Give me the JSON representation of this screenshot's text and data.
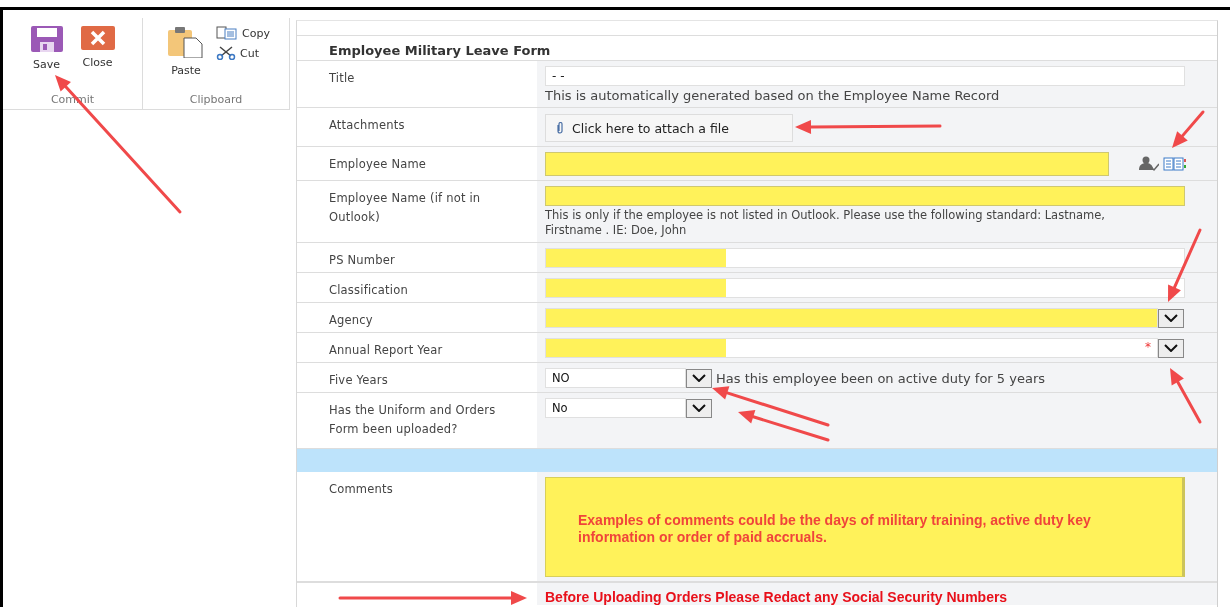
{
  "ribbon": {
    "groups": [
      {
        "label": "Commit",
        "buttons": [
          {
            "label": "Save"
          },
          {
            "label": "Close"
          }
        ]
      },
      {
        "label": "Clipboard",
        "buttons": [
          {
            "label": "Paste"
          },
          {
            "label": "Copy"
          },
          {
            "label": "Cut"
          }
        ]
      }
    ]
  },
  "form": {
    "title": "Employee Military Leave Form",
    "sections": [
      {
        "rows": [
          {
            "kind": "text",
            "label": "Title",
            "value": "- -",
            "highlighted": false,
            "hint": "This is automatically generated based on the Employee Name Record"
          },
          {
            "kind": "attach",
            "label": "Attachments",
            "button": "Click here to attach a file"
          },
          {
            "kind": "people",
            "label": "Employee Name",
            "highlighted": true
          },
          {
            "kind": "text",
            "label": "Employee Name (if not in Outlook)",
            "highlighted": true,
            "hint": "This is only if the employee is not listed in Outlook.  Please use the following standard:  Lastname, Firstname .  IE:  Doe, John"
          },
          {
            "kind": "partial_text",
            "label": "PS Number",
            "highlighted": true
          },
          {
            "kind": "partial_text",
            "label": "Classification",
            "highlighted": true
          },
          {
            "kind": "select",
            "label": "Agency",
            "highlighted": true
          },
          {
            "kind": "partial_select",
            "label": "Annual Report Year",
            "highlighted": true,
            "required_mark": "*"
          },
          {
            "kind": "small_select",
            "label": "Five Years",
            "highlighted": false,
            "value": "NO",
            "note": "Has this employee been on active duty for 5 years"
          },
          {
            "kind": "small_select",
            "label": "Has the Uniform and Orders Form been uploaded?",
            "highlighted": false,
            "value": "No"
          }
        ]
      },
      {
        "rows": [
          {
            "kind": "textarea",
            "label": "Comments",
            "highlighted": true,
            "placeholder": "Examples of comments could be the days of military training, active duty key information or order of paid accruals."
          }
        ]
      }
    ],
    "notice": "Before Uploading Orders Please Redact any Social Security Numbers"
  }
}
